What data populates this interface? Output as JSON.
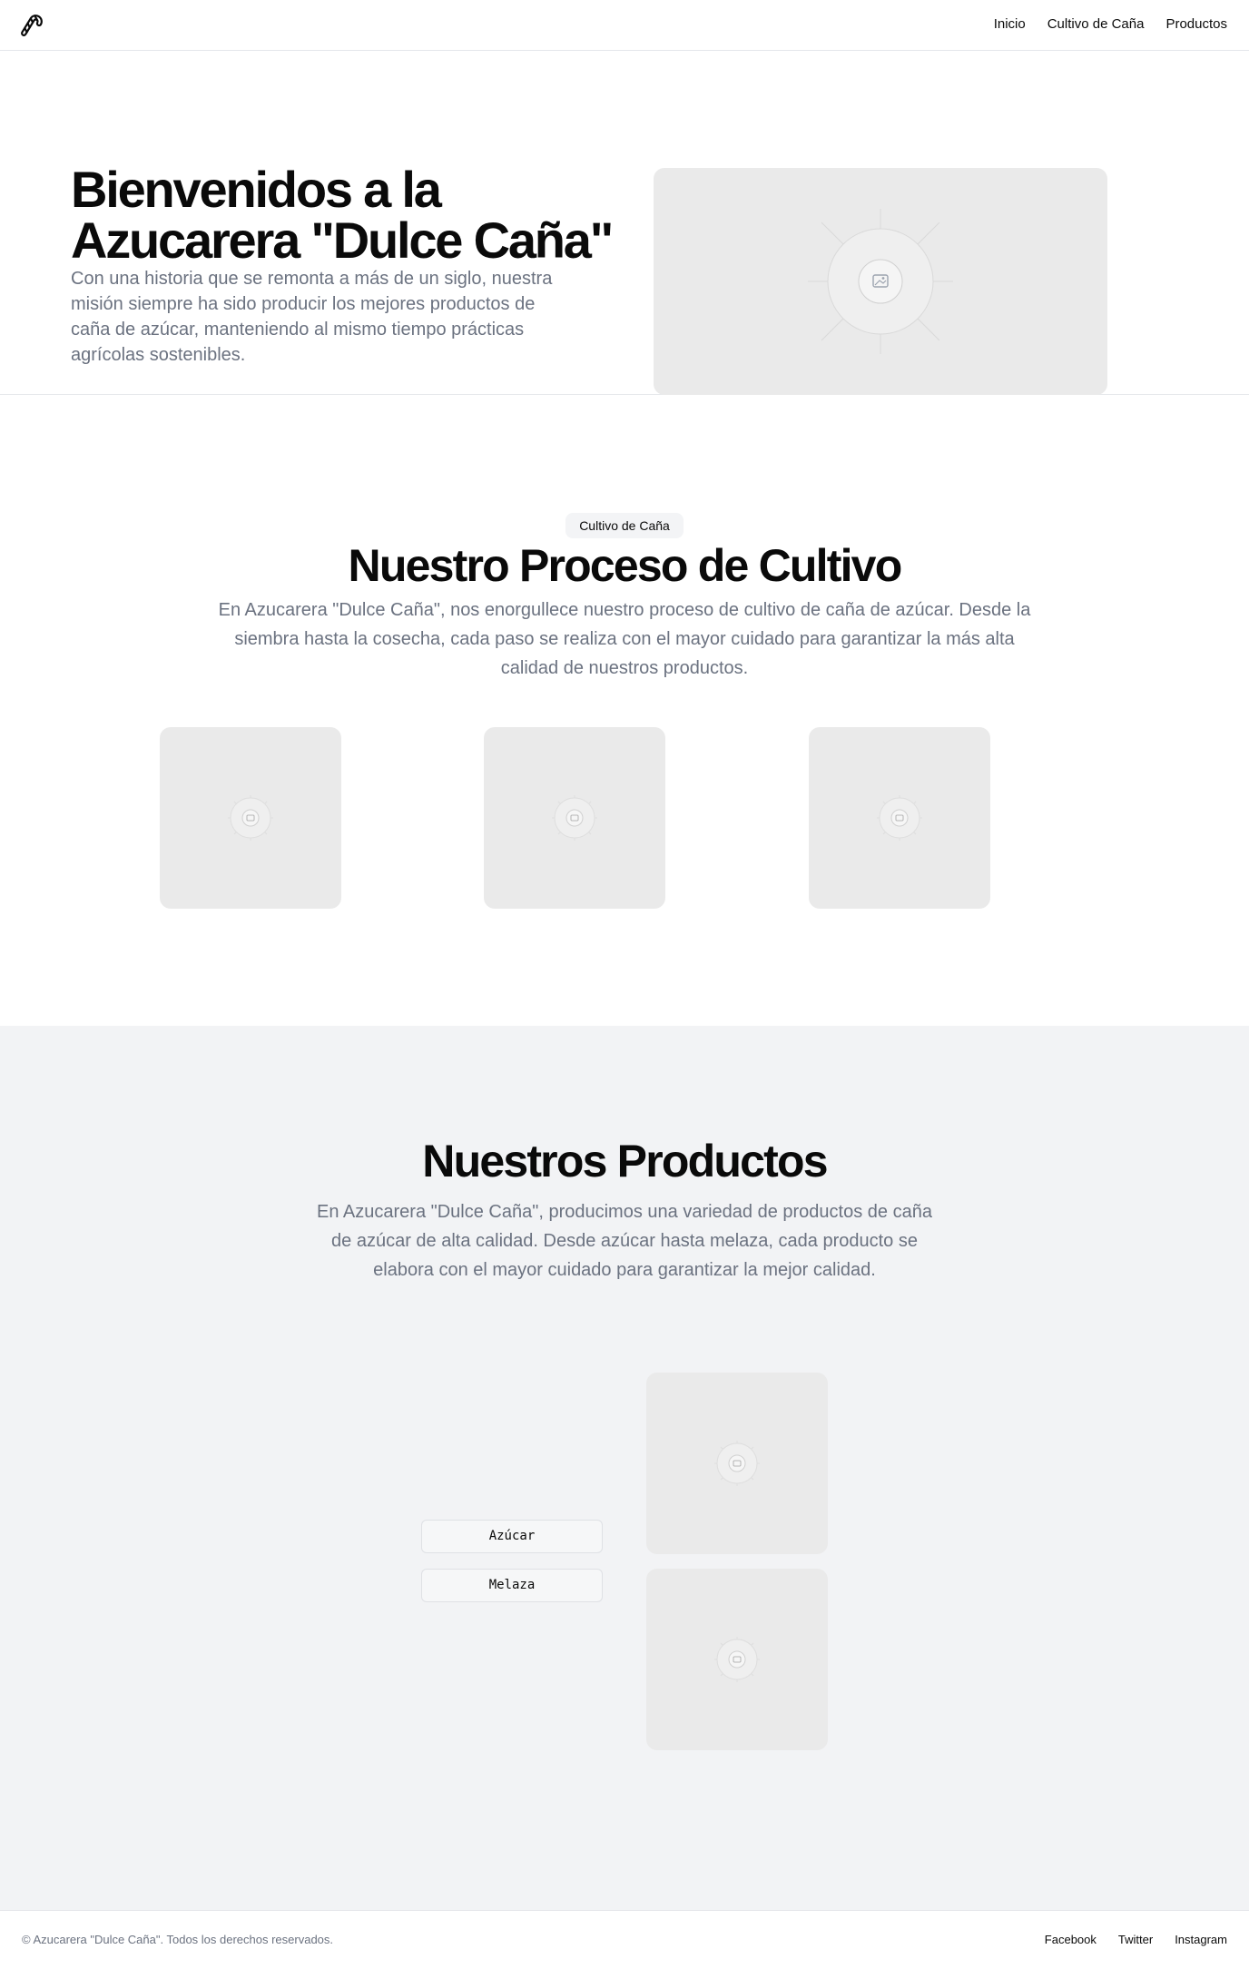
{
  "header": {
    "logo_icon": "candy-cane-icon",
    "nav": [
      {
        "label": "Inicio"
      },
      {
        "label": "Cultivo de Caña"
      },
      {
        "label": "Productos"
      }
    ]
  },
  "hero": {
    "title": "Bienvenidos a la Azucarera \"Dulce Caña\"",
    "description": "Con una historia que se remonta a más de un siglo, nuestra misión siempre ha sido producir los mejores productos de caña de azúcar, manteniendo al mismo tiempo prácticas agrícolas sostenibles.",
    "image_icon": "image-placeholder-icon"
  },
  "cultivation": {
    "badge": "Cultivo de Caña",
    "title": "Nuestro Proceso de Cultivo",
    "description": "En Azucarera \"Dulce Caña\", nos enorgullece nuestro proceso de cultivo de caña de azúcar. Desde la siembra hasta la cosecha, cada paso se realiza con el mayor cuidado para garantizar la más alta calidad de nuestros productos."
  },
  "products": {
    "title": "Nuestros Productos",
    "description": "En Azucarera \"Dulce Caña\", producimos una variedad de productos de caña de azúcar de alta calidad. Desde azúcar hasta melaza, cada producto se elabora con el mayor cuidado para garantizar la mejor calidad.",
    "buttons": [
      {
        "label": "Azúcar"
      },
      {
        "label": "Melaza"
      }
    ]
  },
  "footer": {
    "copyright": "© Azucarera \"Dulce Caña\". Todos los derechos reservados.",
    "links": [
      {
        "label": "Facebook"
      },
      {
        "label": "Twitter"
      },
      {
        "label": "Instagram"
      }
    ]
  }
}
